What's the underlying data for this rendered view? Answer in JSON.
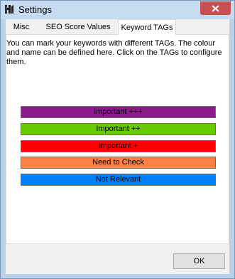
{
  "window": {
    "title": "Settings"
  },
  "tabs": [
    {
      "label": "Misc"
    },
    {
      "label": "SEO Score Values"
    },
    {
      "label": "Keyword TAGs"
    }
  ],
  "panel": {
    "description": "You can mark your keywords with different TAGs. The colour and name can be defined here. Click on the TAGs to configure them."
  },
  "tags": [
    {
      "label": "Important +++",
      "color": "#8b1a8b",
      "text_color": "#000000"
    },
    {
      "label": "Important ++",
      "color": "#66cc00",
      "text_color": "#000000"
    },
    {
      "label": "Important +",
      "color": "#ff0000",
      "text_color": "#000000"
    },
    {
      "label": "Need to Check",
      "color": "#ff8040",
      "text_color": "#000000"
    },
    {
      "label": "Not Relevant",
      "color": "#0080ff",
      "text_color": "#000000"
    }
  ],
  "footer": {
    "ok_label": "OK"
  },
  "colors": {
    "titlebar": "#c6daf0",
    "close_button": "#c75050"
  },
  "icons": {
    "app": "app-logo-icon",
    "close": "close-icon"
  }
}
